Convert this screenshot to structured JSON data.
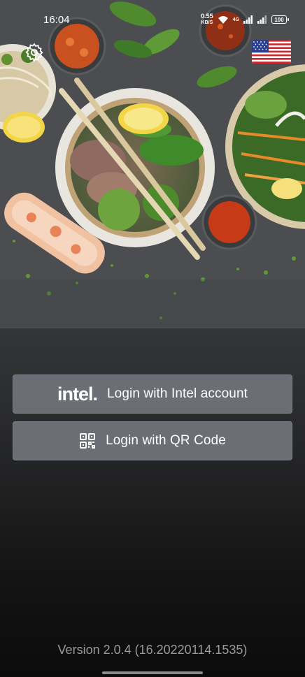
{
  "status_bar": {
    "time": "16:04",
    "net_speed_value": "0.55",
    "net_speed_unit": "KB/S",
    "network": "4G",
    "battery": "100"
  },
  "header": {
    "settings_icon": "gear-icon",
    "language_flag": "us-flag-icon"
  },
  "login": {
    "intel_logo_text": "intel.",
    "intel_label": "Login with Intel account",
    "qr_label": "Login with QR Code",
    "qr_icon": "qr-code-icon"
  },
  "footer": {
    "version": "Version 2.0.4 (16.20220114.1535)"
  },
  "colors": {
    "button_bg": "#6b6f75",
    "version_text": "#9a9a9a"
  }
}
